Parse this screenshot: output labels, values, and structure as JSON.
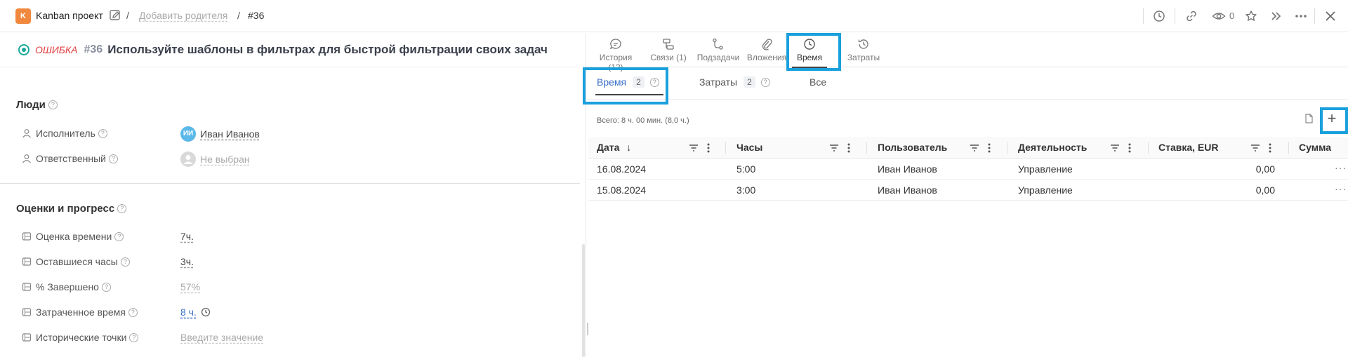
{
  "breadcrumb": {
    "project_badge": "K",
    "project_name": "Kanban проект",
    "separator": "/",
    "add_parent": "Добавить родителя",
    "issue_ref": "#36"
  },
  "toolbar": {
    "watchers_count": "0",
    "icons": [
      "clock-icon",
      "link-icon",
      "eye-icon",
      "star-icon",
      "double-chevron-icon",
      "more-icon",
      "close-icon"
    ]
  },
  "issue": {
    "type": "ОШИБКА",
    "id": "#36",
    "title": "Используйте шаблоны в фильтрах для быстрой фильтрации своих задач",
    "status_color": "#1aa99a"
  },
  "people": {
    "section_title": "Люди",
    "assignee_label": "Исполнитель",
    "assignee_initials": "ИИ",
    "assignee_value": "Иван Иванов",
    "responsible_label": "Ответственный",
    "responsible_value": "Не выбран"
  },
  "estimates": {
    "section_title": "Оценки и прогресс",
    "estimate_label": "Оценка времени",
    "estimate_value": "7ч.",
    "remaining_label": "Оставшиеся часы",
    "remaining_value": "3ч.",
    "done_label": "% Завершено",
    "done_value": "57%",
    "spent_label": "Затраченное время",
    "spent_value": "8 ч.",
    "story_points_label": "Исторические точки",
    "story_points_placeholder": "Введите значение"
  },
  "main_tabs": [
    {
      "label": "История (12)",
      "icon": "chat-icon"
    },
    {
      "label": "Связи (1)",
      "icon": "relations-icon"
    },
    {
      "label": "Подзадачи",
      "icon": "subtasks-icon"
    },
    {
      "label": "Вложения",
      "icon": "paperclip-icon"
    },
    {
      "label": "Время",
      "icon": "clock-icon"
    },
    {
      "label": "Затраты",
      "icon": "history-icon"
    }
  ],
  "sub_tabs": {
    "time_label": "Время",
    "time_count": "2",
    "costs_label": "Затраты",
    "costs_count": "2",
    "all_label": "Все"
  },
  "summary": {
    "total": "Всего: 8 ч. 00 мин. (8,0 ч.)",
    "add_symbol": "+"
  },
  "table": {
    "columns": [
      "Дата",
      "Часы",
      "Пользователь",
      "Деятельность",
      "Ставка, EUR",
      "Сумма"
    ],
    "sort_arrow": "↓",
    "rows": [
      {
        "date": "16.08.2024",
        "hours": "5:00",
        "user": "Иван Иванов",
        "activity": "Управление",
        "rate": "0,00"
      },
      {
        "date": "15.08.2024",
        "hours": "3:00",
        "user": "Иван Иванов",
        "activity": "Управление",
        "rate": "0,00"
      }
    ],
    "row_more": "···"
  },
  "colors": {
    "highlight": "#1aa0dc",
    "accent_link": "#3b6fc9",
    "error": "#e03e3e",
    "project_badge": "#f0883e"
  }
}
